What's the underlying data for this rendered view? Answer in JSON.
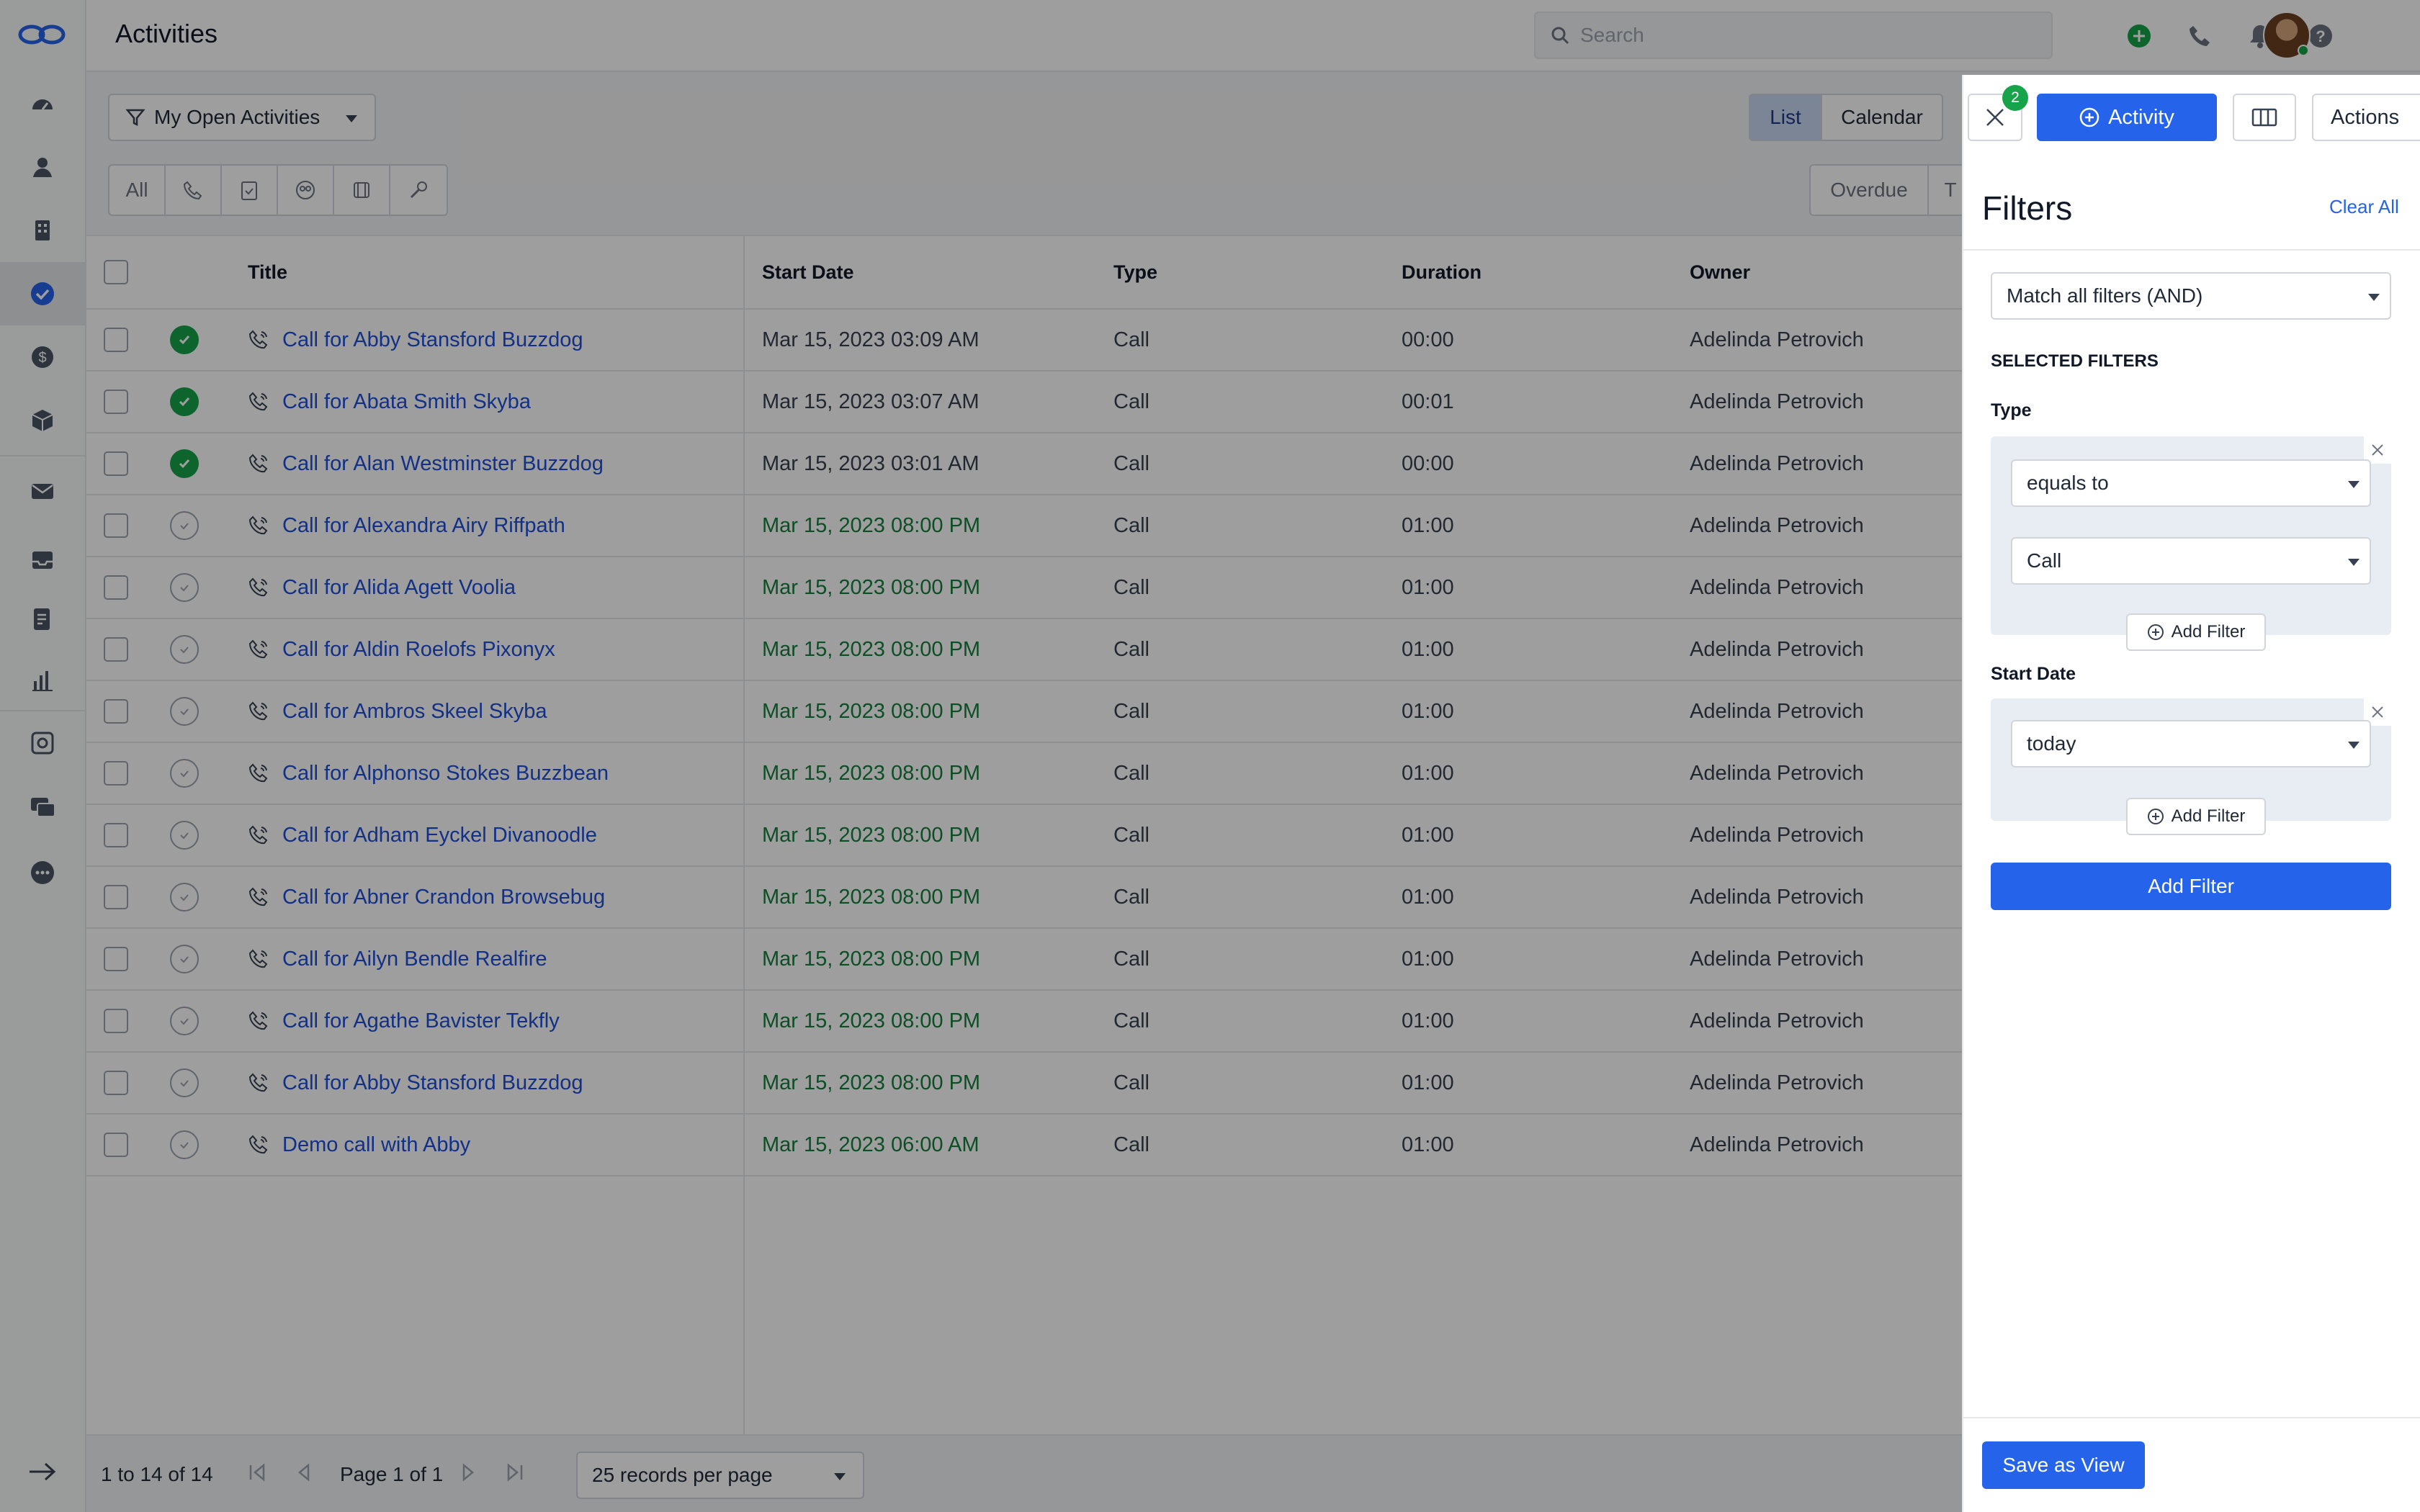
{
  "header": {
    "title": "Activities",
    "search_placeholder": "Search"
  },
  "sidebar": {
    "items": [
      {
        "name": "dashboard-icon"
      },
      {
        "name": "contacts-icon"
      },
      {
        "name": "companies-icon"
      },
      {
        "name": "activities-icon",
        "active": true
      },
      {
        "name": "deals-icon"
      },
      {
        "name": "products-icon"
      },
      {
        "name": "mail-icon"
      },
      {
        "name": "inbox-icon"
      },
      {
        "name": "documents-icon"
      },
      {
        "name": "insights-icon"
      },
      {
        "name": "settings-icon"
      },
      {
        "name": "chat-icon"
      },
      {
        "name": "more-icon"
      }
    ],
    "collapse_icon": "arrow-right-icon"
  },
  "toolbar": {
    "filter_label": "My Open Activities",
    "type_tabs": [
      "All"
    ],
    "view_tabs": [
      "List",
      "Calendar"
    ],
    "due_tabs": [
      "Overdue",
      "T"
    ]
  },
  "table": {
    "columns": [
      "Title",
      "Start Date",
      "Type",
      "Duration",
      "Owner"
    ],
    "rows": [
      {
        "done": true,
        "title": "Call for Abby Stansford Buzzdog",
        "start": "Mar 15, 2023 03:09 AM",
        "type": "Call",
        "duration": "00:00",
        "owner": "Adelinda Petrovich"
      },
      {
        "done": true,
        "title": "Call for Abata Smith Skyba",
        "start": "Mar 15, 2023 03:07 AM",
        "type": "Call",
        "duration": "00:01",
        "owner": "Adelinda Petrovich"
      },
      {
        "done": true,
        "title": "Call for Alan Westminster Buzzdog",
        "start": "Mar 15, 2023 03:01 AM",
        "type": "Call",
        "duration": "00:00",
        "owner": "Adelinda Petrovich"
      },
      {
        "done": false,
        "title": "Call for Alexandra Airy Riffpath",
        "start": "Mar 15, 2023 08:00 PM",
        "type": "Call",
        "duration": "01:00",
        "owner": "Adelinda Petrovich"
      },
      {
        "done": false,
        "title": "Call for Alida Agett Voolia",
        "start": "Mar 15, 2023 08:00 PM",
        "type": "Call",
        "duration": "01:00",
        "owner": "Adelinda Petrovich"
      },
      {
        "done": false,
        "title": "Call for Aldin Roelofs Pixonyx",
        "start": "Mar 15, 2023 08:00 PM",
        "type": "Call",
        "duration": "01:00",
        "owner": "Adelinda Petrovich"
      },
      {
        "done": false,
        "title": "Call for Ambros Skeel Skyba",
        "start": "Mar 15, 2023 08:00 PM",
        "type": "Call",
        "duration": "01:00",
        "owner": "Adelinda Petrovich"
      },
      {
        "done": false,
        "title": "Call for Alphonso Stokes Buzzbean",
        "start": "Mar 15, 2023 08:00 PM",
        "type": "Call",
        "duration": "01:00",
        "owner": "Adelinda Petrovich"
      },
      {
        "done": false,
        "title": "Call for Adham Eyckel Divanoodle",
        "start": "Mar 15, 2023 08:00 PM",
        "type": "Call",
        "duration": "01:00",
        "owner": "Adelinda Petrovich"
      },
      {
        "done": false,
        "title": "Call for Abner Crandon Browsebug",
        "start": "Mar 15, 2023 08:00 PM",
        "type": "Call",
        "duration": "01:00",
        "owner": "Adelinda Petrovich"
      },
      {
        "done": false,
        "title": "Call for Ailyn Bendle Realfire",
        "start": "Mar 15, 2023 08:00 PM",
        "type": "Call",
        "duration": "01:00",
        "owner": "Adelinda Petrovich"
      },
      {
        "done": false,
        "title": "Call for Agathe Bavister Tekfly",
        "start": "Mar 15, 2023 08:00 PM",
        "type": "Call",
        "duration": "01:00",
        "owner": "Adelinda Petrovich"
      },
      {
        "done": false,
        "title": "Call for Abby Stansford Buzzdog",
        "start": "Mar 15, 2023 08:00 PM",
        "type": "Call",
        "duration": "01:00",
        "owner": "Adelinda Petrovich"
      },
      {
        "done": false,
        "title": "Demo call with Abby",
        "start": "Mar 15, 2023 06:00 AM",
        "type": "Call",
        "duration": "01:00",
        "owner": "Adelinda Petrovich"
      }
    ]
  },
  "footer": {
    "range": "1 to 14 of 14",
    "page": "Page 1 of 1",
    "per_page": "25 records per page"
  },
  "panel": {
    "badge_count": "2",
    "activity_label": "Activity",
    "actions_label": "Actions",
    "title": "Filters",
    "clear_all": "Clear All",
    "match_mode": "Match all filters (AND)",
    "section_label": "SELECTED FILTERS",
    "filters": [
      {
        "label": "Type",
        "operator": "equals to",
        "value": "Call",
        "add_label": "Add Filter"
      },
      {
        "label": "Start Date",
        "operator": "today",
        "add_label": "Add Filter"
      }
    ],
    "add_filter_label": "Add Filter",
    "save_view_label": "Save as View"
  },
  "colors": {
    "accent": "#2563eb",
    "link": "#1d4ed8",
    "success": "#16a34a",
    "upcoming_date": "#15803d"
  }
}
